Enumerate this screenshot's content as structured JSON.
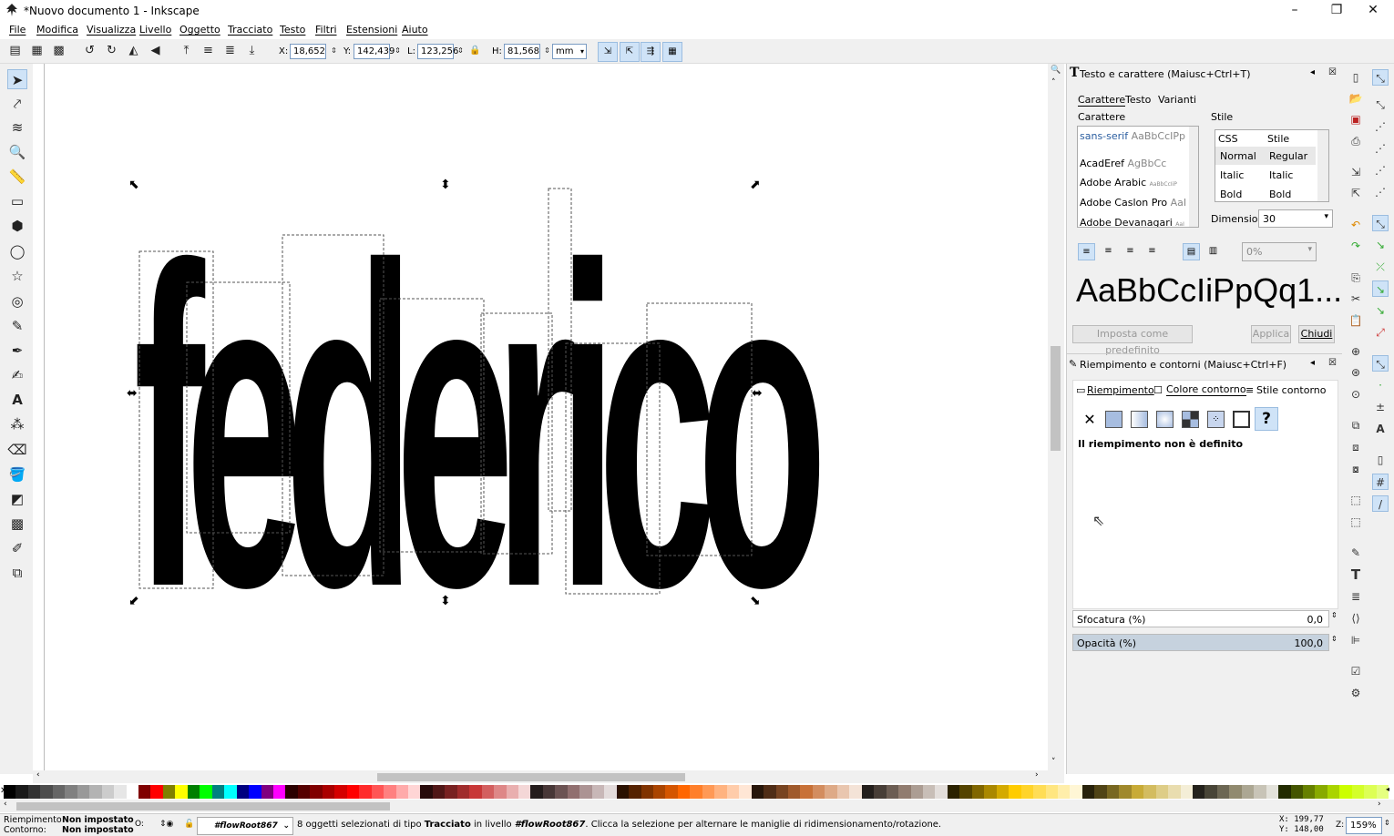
{
  "window": {
    "title": "*Nuovo documento 1 - Inkscape",
    "minimize": "–",
    "maximize": "❐",
    "close": "✕"
  },
  "menu": [
    "File",
    "Modifica",
    "Visualizza",
    "Livello",
    "Oggetto",
    "Tracciato",
    "Testo",
    "Filtri",
    "Estensioni",
    "Aiuto"
  ],
  "toolbar": {
    "x_label": "X:",
    "x_value": "18,652",
    "y_label": "Y:",
    "y_value": "142,439",
    "w_label": "L:",
    "w_value": "123,256",
    "h_label": "H:",
    "h_value": "81,568",
    "unit": "mm"
  },
  "canvas": {
    "text": "federico"
  },
  "text_panel": {
    "title": "Testo e carattere (Maiusc+Ctrl+T)",
    "tabs": [
      "Carattere",
      "Testo",
      "Varianti"
    ],
    "font_group": "Carattere",
    "style_group": "Stile",
    "fonts": [
      {
        "name": "sans-serif",
        "sample": "AaBbCcIPp"
      },
      {
        "name": "AcadEref",
        "sample": "AgBbCc"
      },
      {
        "name": "Adobe Arabic",
        "sample": "AaBbCcIiP"
      },
      {
        "name": "Adobe Caslon Pro",
        "sample": "AaI"
      },
      {
        "name": "Adobe Devanagari",
        "sample": "AaI"
      }
    ],
    "style_headers": [
      "CSS",
      "Stile"
    ],
    "styles": [
      [
        "Normal",
        "Regular"
      ],
      [
        "Italic",
        "Italic"
      ],
      [
        "Bold",
        "Bold"
      ]
    ],
    "size_label": "Dimensione",
    "size_value": "30",
    "spacing_value": "0%",
    "preview": "AaBbCcIiPpQq1...",
    "set_default": "Imposta come predefinito",
    "apply": "Applica",
    "close": "Chiudi"
  },
  "fill_panel": {
    "title": "Riempimento e contorni (Maiusc+Ctrl+F)",
    "tabs": [
      "Riempimento",
      "Colore contorno",
      "Stile contorno"
    ],
    "message": "Il riempimento non è definito",
    "blur_label": "Sfocatura (%)",
    "blur_value": "0,0",
    "opacity_label": "Opacità (%)",
    "opacity_value": "100,0",
    "opacity_level": 1.0
  },
  "status": {
    "fill_label": "Riempimento:",
    "fill_value": "Non impostato",
    "stroke_label": "Contorno:",
    "stroke_value": "Non impostato",
    "o_label": "O:",
    "layer": "#flowRoot867",
    "msg_pre": "8 oggetti selezionati di tipo ",
    "msg_type": "Tracciato",
    "msg_mid": " in livello ",
    "msg_layer": "#flowRoot867",
    "msg_post": ". Clicca la selezione per alternare le maniglie di ridimensionamento/rotazione.",
    "x_coord": "X: 199,77",
    "y_coord": "Y: 148,00",
    "zoom_label": "Z:",
    "zoom_value": "159%"
  },
  "colors": {
    "accent": "#cfe3f7",
    "panel_bg": "#f0f0f0"
  },
  "palette": [
    "#000000",
    "#1a1a1a",
    "#333333",
    "#4d4d4d",
    "#666666",
    "#808080",
    "#999999",
    "#b3b3b3",
    "#cccccc",
    "#e6e6e6",
    "#ffffff",
    "#800000",
    "#ff0000",
    "#808000",
    "#ffff00",
    "#008000",
    "#00ff00",
    "#008080",
    "#00ffff",
    "#000080",
    "#0000ff",
    "#800080",
    "#ff00ff",
    "#2b0000",
    "#550000",
    "#800000",
    "#aa0000",
    "#d40000",
    "#ff0000",
    "#ff2a2a",
    "#ff5555",
    "#ff8080",
    "#ffaaaa",
    "#ffd5d5",
    "#280b0b",
    "#501616",
    "#782121",
    "#a02c2c",
    "#c83737",
    "#d35f5f",
    "#de8787",
    "#e9afaf",
    "#f4d7d7",
    "#241c1c",
    "#483737",
    "#6c5353",
    "#916f6f",
    "#ac9393",
    "#c8b7b7",
    "#e3dbdb",
    "#2b1100",
    "#552200",
    "#803300",
    "#aa4400",
    "#d45500",
    "#ff6600",
    "#ff7f2a",
    "#ff9955",
    "#ffb380",
    "#ffccaa",
    "#ffe6d5",
    "#28170b",
    "#502d16",
    "#784421",
    "#a05a2c",
    "#c87137",
    "#d38d5f",
    "#deaa87",
    "#e9c6af",
    "#f4e3d7",
    "#241f1c",
    "#483e37",
    "#6c5d53",
    "#917c6f",
    "#ac9d93",
    "#c8beb7",
    "#e3dedb",
    "#2b2200",
    "#554400",
    "#806600",
    "#aa8800",
    "#d4aa00",
    "#ffcc00",
    "#ffd42a",
    "#ffdd55",
    "#ffe680",
    "#ffeeaa",
    "#fff6d5",
    "#28220b",
    "#504416",
    "#786721",
    "#a0892c",
    "#c8ab37",
    "#d3bc5f",
    "#decd87",
    "#e9ddaf",
    "#f4eed7",
    "#24221c",
    "#484537",
    "#6c6753",
    "#918a6f",
    "#aca793",
    "#c8c4b7",
    "#e3e2db",
    "#222b00",
    "#445500",
    "#668000",
    "#88aa00",
    "#aad400",
    "#ccff00",
    "#d4ff2a",
    "#ddff55",
    "#e5ff80"
  ]
}
